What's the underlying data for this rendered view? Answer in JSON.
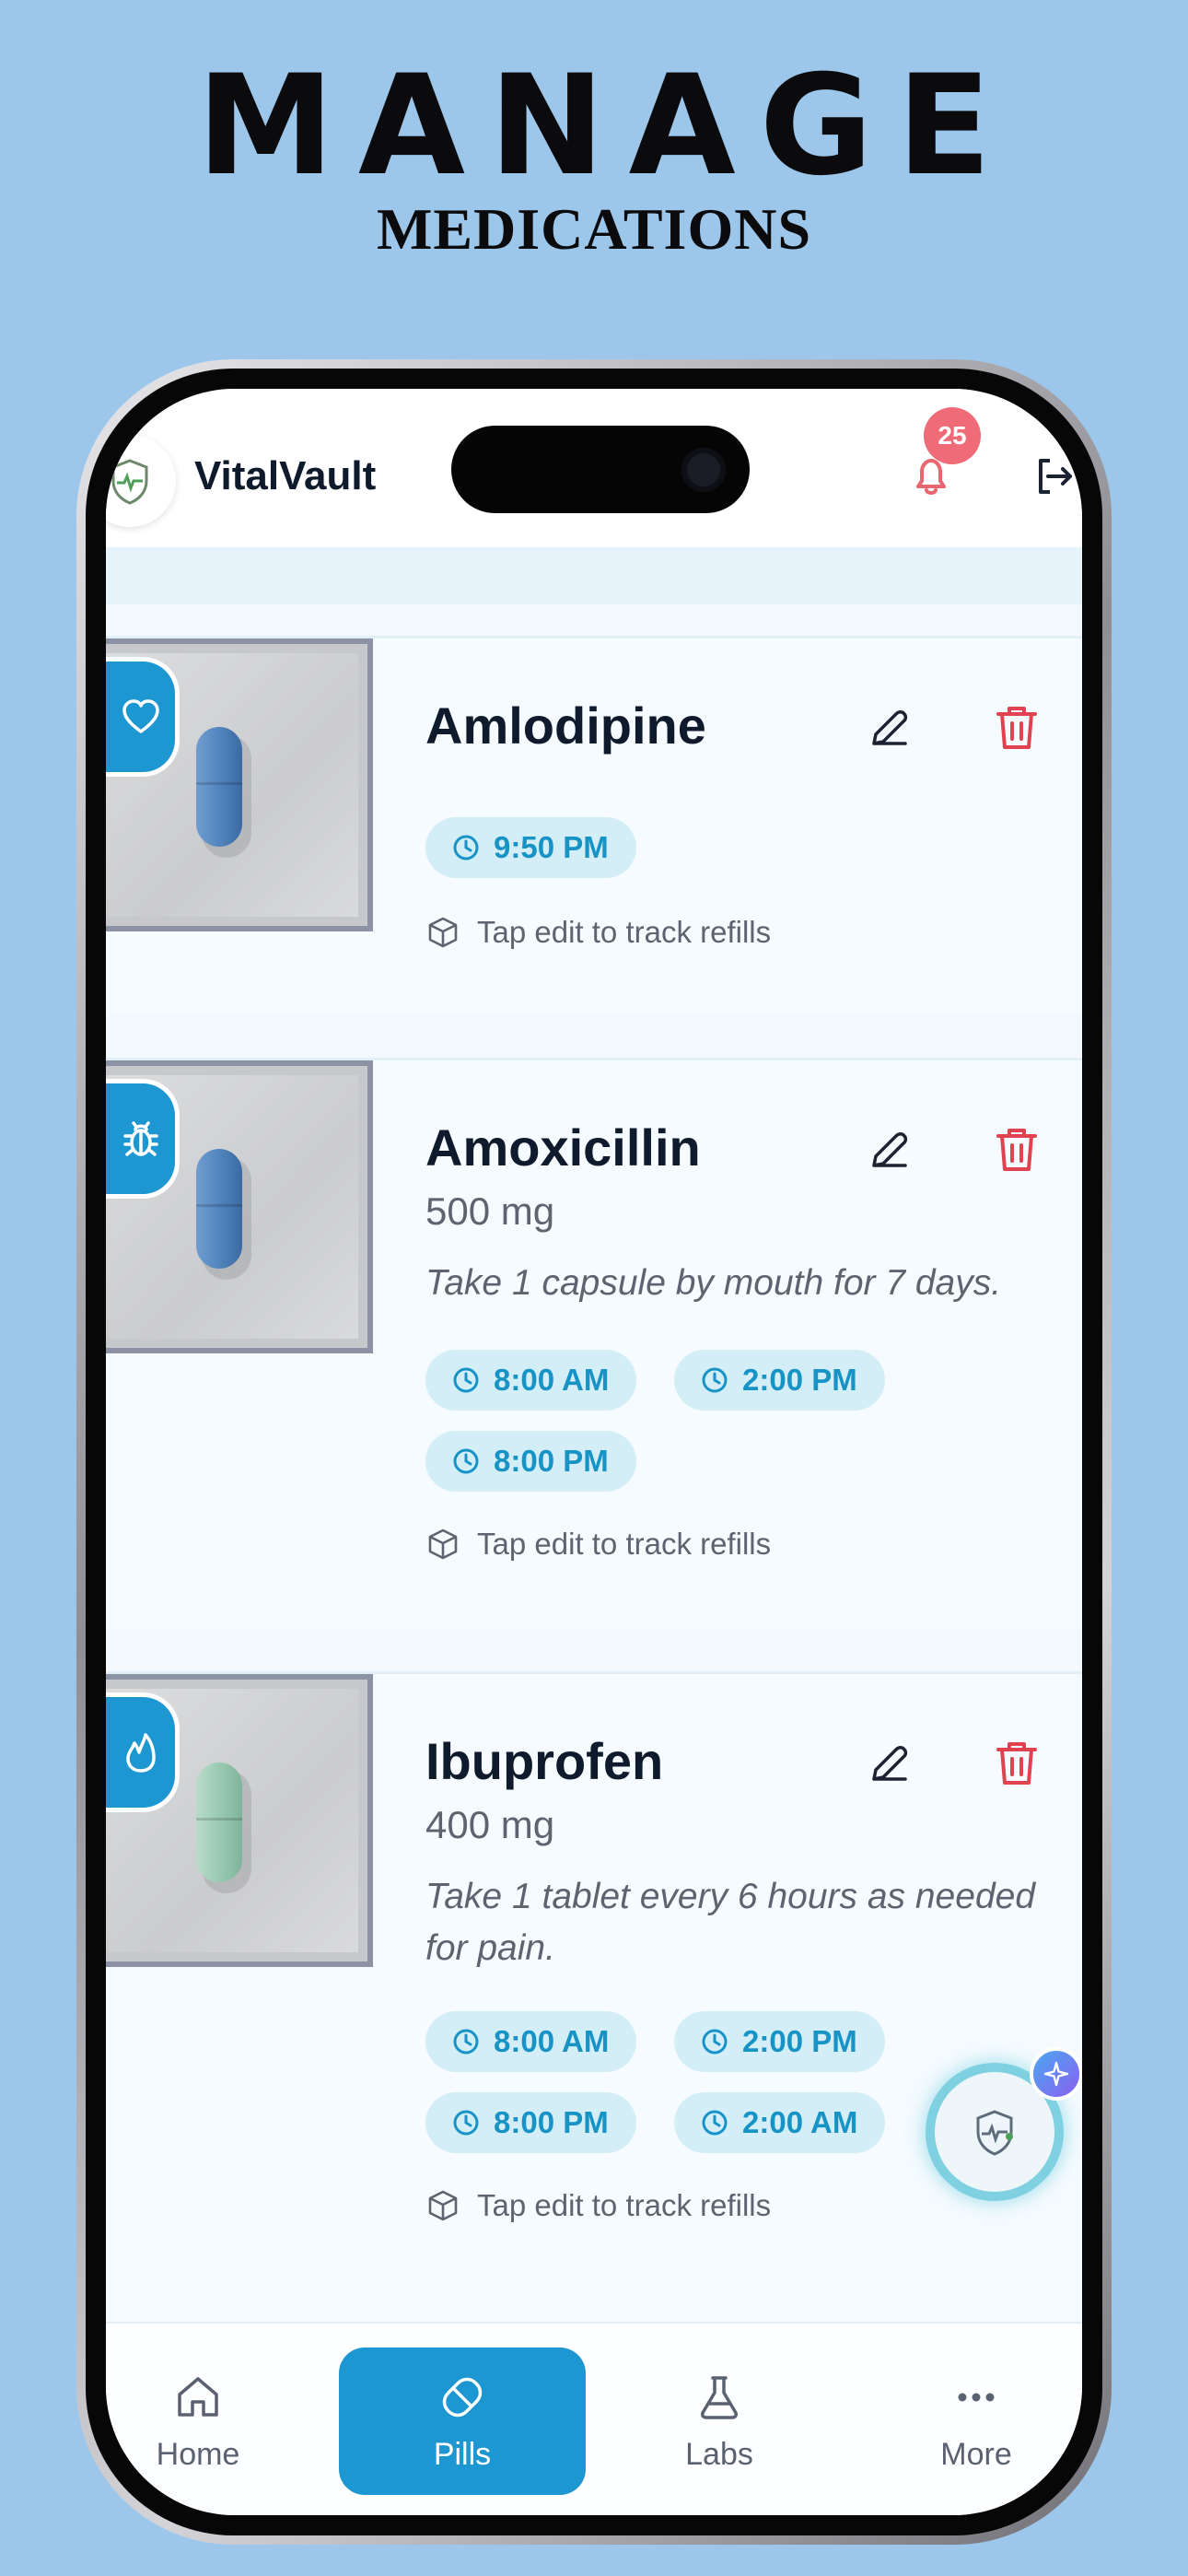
{
  "hero": {
    "title": "MANAGE",
    "subtitle": "MEDICATIONS"
  },
  "header": {
    "app_name": "VitalVault",
    "notification_count": "25"
  },
  "medications": [
    {
      "name": "Amlodipine",
      "dose": "",
      "instructions": "",
      "times": [
        "9:50 PM"
      ],
      "refill": "Tap edit to track refills",
      "tag_icon": "heart-icon"
    },
    {
      "name": "Amoxicillin",
      "dose": "500 mg",
      "instructions": "Take 1 capsule by mouth for 7 days.",
      "times": [
        "8:00 AM",
        "2:00 PM",
        "8:00 PM"
      ],
      "refill": "Tap edit to track refills",
      "tag_icon": "bug-icon"
    },
    {
      "name": "Ibuprofen",
      "dose": "400 mg",
      "instructions": "Take 1 tablet every 6 hours as needed for pain.",
      "times": [
        "8:00 AM",
        "2:00 PM",
        "8:00 PM",
        "2:00 AM"
      ],
      "refill": "Tap edit to track refills",
      "tag_icon": "flame-icon"
    }
  ],
  "nav": {
    "home": "Home",
    "pills": "Pills",
    "labs": "Labs",
    "more": "More"
  },
  "colors": {
    "accent": "#1c97d1",
    "danger": "#e0434f",
    "badge": "#f06b78",
    "chip_bg": "#d4eef8"
  }
}
